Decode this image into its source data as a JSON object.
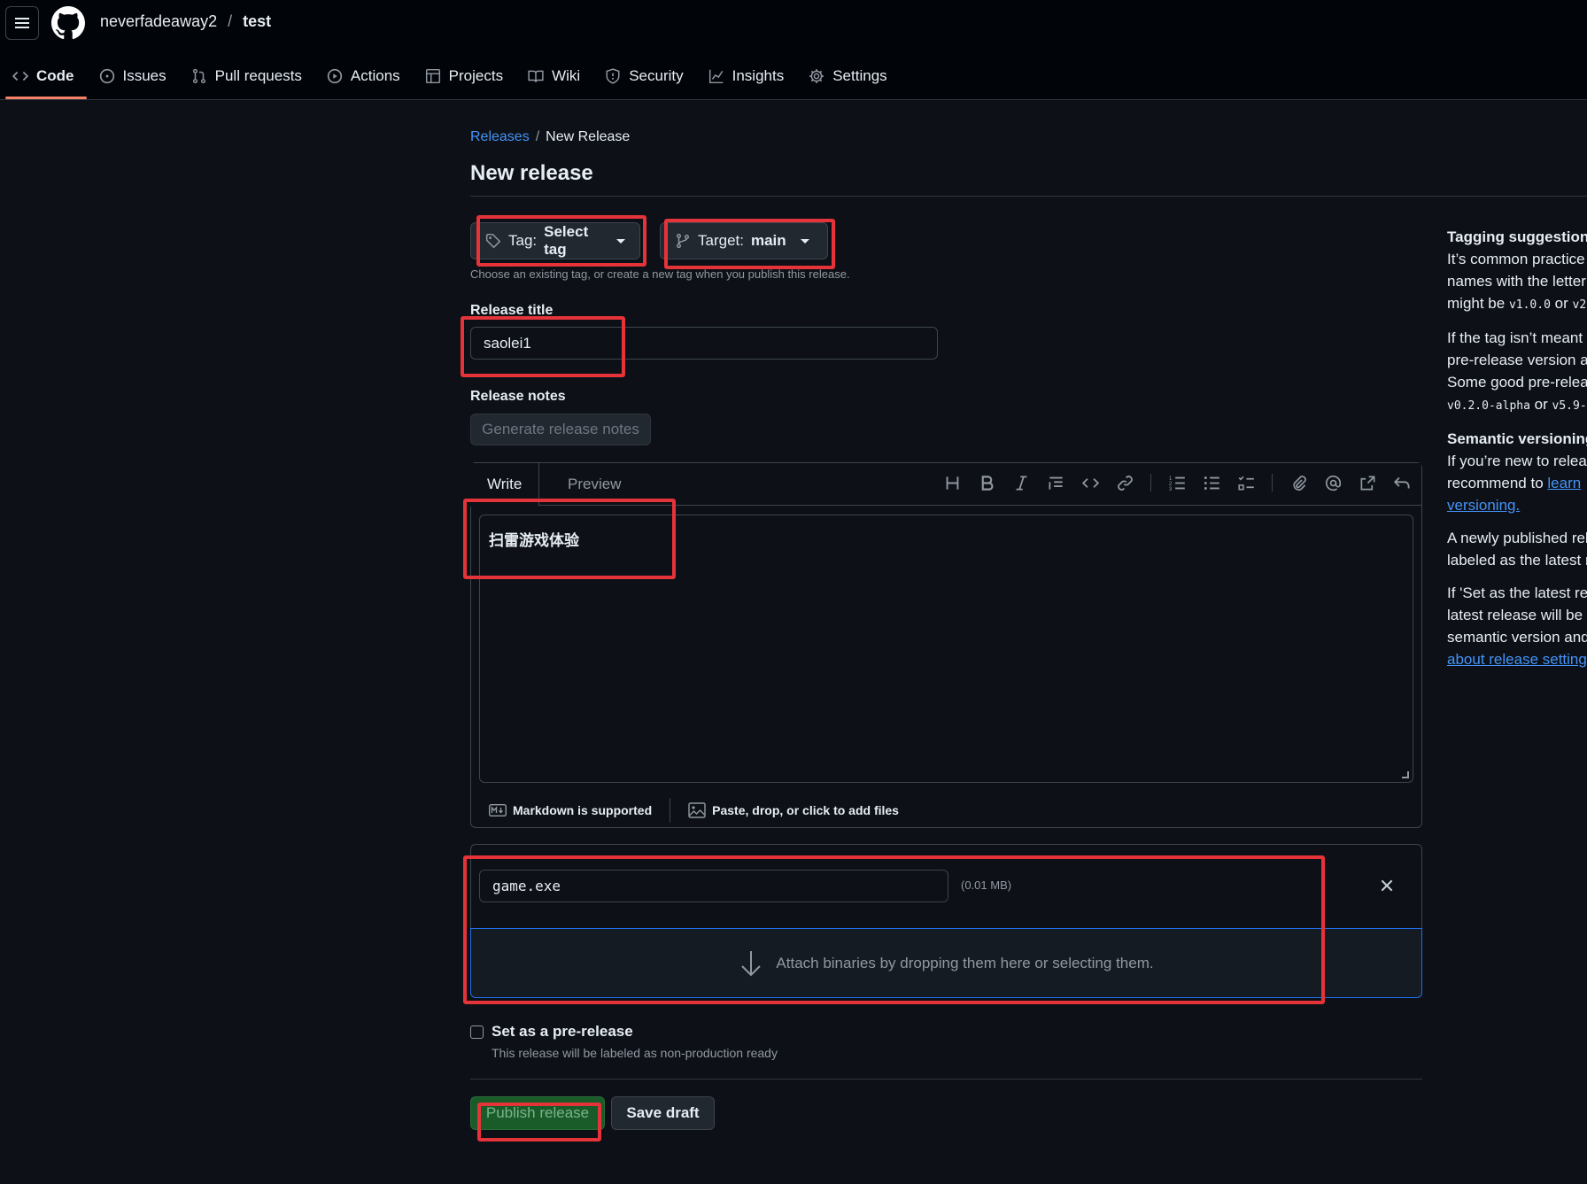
{
  "header": {
    "owner": "neverfadeaway2",
    "separator": "/",
    "repo": "test",
    "nav": [
      {
        "label": "Code",
        "icon": "code-icon",
        "active": true
      },
      {
        "label": "Issues",
        "icon": "issue-icon"
      },
      {
        "label": "Pull requests",
        "icon": "pull-request-icon"
      },
      {
        "label": "Actions",
        "icon": "play-icon"
      },
      {
        "label": "Projects",
        "icon": "table-icon"
      },
      {
        "label": "Wiki",
        "icon": "book-icon"
      },
      {
        "label": "Security",
        "icon": "shield-icon"
      },
      {
        "label": "Insights",
        "icon": "graph-icon"
      },
      {
        "label": "Settings",
        "icon": "gear-icon"
      }
    ]
  },
  "breadcrumb": {
    "parent": "Releases",
    "sep": "/",
    "current": "New Release"
  },
  "page_title": "New release",
  "tag_button": {
    "prefix": "Tag:",
    "value": "Select tag"
  },
  "target_button": {
    "prefix": "Target:",
    "value": "main"
  },
  "tag_hint": "Choose an existing tag, or create a new tag when you publish this release.",
  "release_title": {
    "label": "Release title",
    "value": "saolei1"
  },
  "release_notes": {
    "label": "Release notes",
    "generate_label": "Generate release notes",
    "tabs": {
      "write": "Write",
      "preview": "Preview"
    },
    "body": "扫雷游戏体验",
    "markdown_hint": "Markdown is supported",
    "attach_hint": "Paste, drop, or click to add files"
  },
  "attachment": {
    "filename": "game.exe",
    "size": "(0.01 MB)",
    "dropzone_text": "Attach binaries by dropping them here or selecting them."
  },
  "prerelease": {
    "label": "Set as a pre-release",
    "hint": "This release will be labeled as non-production ready",
    "checked": false
  },
  "actions": {
    "publish": "Publish release",
    "draft": "Save draft"
  },
  "sidebar": {
    "tagging_title": "Tagging suggestions",
    "tagging_line1": "It’s common practice",
    "tagging_line2": "names with the letter",
    "tagging_line3_pre": "might be",
    "tagging_code1": "v1.0.0",
    "tagging_line3_mid": "or",
    "tagging_code2": "v2",
    "pre_line1": "If the tag isn’t meant",
    "pre_line2": "pre-release version at",
    "pre_line3": "Some good pre-relea",
    "pre_code1": "v0.2.0-alpha",
    "pre_mid": "or",
    "pre_code2": "v5.9-",
    "semver_title": "Semantic versioning",
    "semver_line1": "If you’re new to relea",
    "semver_line2_pre": "recommend to",
    "semver_link1": "learn",
    "semver_link2": "versioning.",
    "latest_line1": "A newly published rel",
    "latest_line2": "labeled as the latest r",
    "set_line1": "If 'Set as the latest rel",
    "set_line2": "latest release will be c",
    "set_line3": "semantic version and",
    "set_link": "about release setting"
  },
  "colors": {
    "accent": "#f78166",
    "link": "#4493f8",
    "annotation": "#e5333a",
    "publish": "#1a5b2a"
  }
}
